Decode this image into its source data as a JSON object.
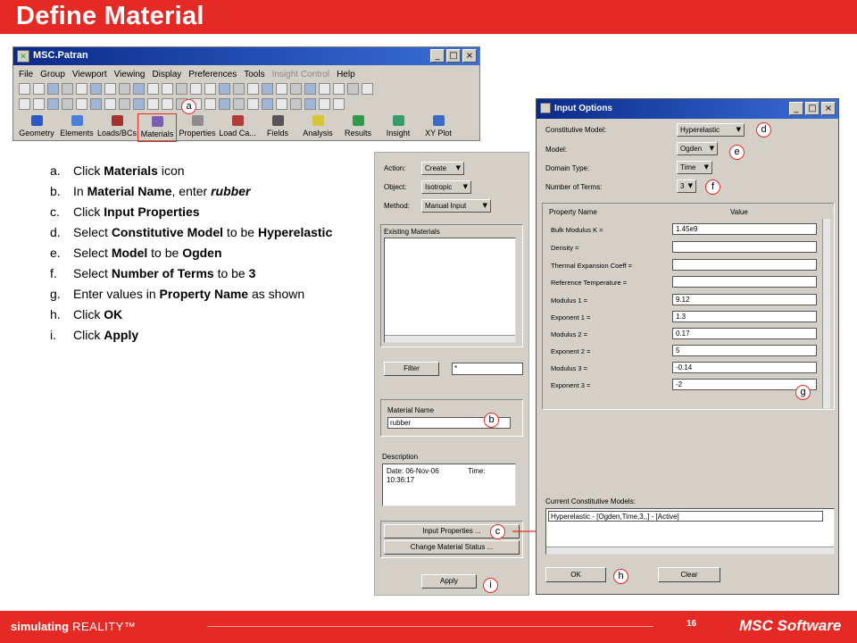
{
  "slide": {
    "title": "Define Material",
    "page_number": "16"
  },
  "patran_window": {
    "title": "MSC.Patran",
    "menu": [
      "File",
      "Group",
      "Viewport",
      "Viewing",
      "Display",
      "Preferences",
      "Tools",
      "Insight Control",
      "Help"
    ],
    "apps": [
      "Geometry",
      "Elements",
      "Loads/BCs",
      "Materials",
      "Properties",
      "Load Ca...",
      "Fields",
      "Analysis",
      "Results",
      "Insight",
      "XY Plot"
    ]
  },
  "steps": [
    {
      "letter": "a.",
      "pre": "Click ",
      "b1": "Materials",
      "mid": " icon",
      "b2": "",
      "post": ""
    },
    {
      "letter": "b.",
      "pre": "In ",
      "b1": "Material Name",
      "mid": ", enter ",
      "b2": "rubber",
      "post": ""
    },
    {
      "letter": "c.",
      "pre": "Click ",
      "b1": "Input Properties",
      "mid": "",
      "b2": "",
      "post": ""
    },
    {
      "letter": "d.",
      "pre": "Select ",
      "b1": "Constitutive Model",
      "mid": " to be ",
      "b2": "Hyperelastic",
      "post": ""
    },
    {
      "letter": "e.",
      "pre": "Select ",
      "b1": "Model",
      "mid": " to be ",
      "b2": "Ogden",
      "post": ""
    },
    {
      "letter": "f.",
      "pre": "Select ",
      "b1": "Number of Terms",
      "mid": " to be ",
      "b2": "3",
      "post": ""
    },
    {
      "letter": "g.",
      "pre": "Enter values in ",
      "b1": "Property Name",
      "mid": " as shown",
      "b2": "",
      "post": ""
    },
    {
      "letter": "h.",
      "pre": "Click ",
      "b1": "OK",
      "mid": "",
      "b2": "",
      "post": ""
    },
    {
      "letter": "i.",
      "pre": "Click ",
      "b1": "Apply",
      "mid": "",
      "b2": "",
      "post": ""
    }
  ],
  "materials_panel": {
    "action_label": "Action:",
    "action_value": "Create",
    "object_label": "Object:",
    "object_value": "Isotropic",
    "method_label": "Method:",
    "method_value": "Manual Input",
    "existing_materials_label": "Existing Materials",
    "filter_button": "Filter",
    "filter_value": "*",
    "material_name_label": "Material Name",
    "material_name_value": "rubber",
    "description_label": "Description",
    "description_line1": "Date: 06-Nov-06",
    "description_time": "Time:",
    "description_line2": "10:36:17",
    "input_properties_button": "Input Properties ...",
    "change_status_button": "Change Material Status ...",
    "apply_button": "Apply"
  },
  "input_options": {
    "title": "Input Options",
    "constitutive_model_label": "Constitutive Model:",
    "constitutive_model_value": "Hyperelastic",
    "model_label": "Model:",
    "model_value": "Ogden",
    "domain_type_label": "Domain Type:",
    "domain_type_value": "Time",
    "number_of_terms_label": "Number of Terms:",
    "number_of_terms_value": "3",
    "col_property": "Property Name",
    "col_value": "Value",
    "properties": [
      {
        "name": "Bulk Modulus K =",
        "value": "1.45e9"
      },
      {
        "name": "Density =",
        "value": ""
      },
      {
        "name": "Thermal Expansion Coeff =",
        "value": ""
      },
      {
        "name": "Reference Temperature =",
        "value": ""
      },
      {
        "name": "Modulus 1 =",
        "value": "9.12"
      },
      {
        "name": "Exponent 1 =",
        "value": "1.3"
      },
      {
        "name": "Modulus 2 =",
        "value": "0.17"
      },
      {
        "name": "Exponent 2 =",
        "value": "5"
      },
      {
        "name": "Modulus 3 =",
        "value": "-0.14"
      },
      {
        "name": "Exponent 3 =",
        "value": "-2"
      }
    ],
    "current_models_label": "Current Constitutive Models:",
    "current_model_value": "Hyperelastic - [Ogden,Time,3,,] - [Active]",
    "ok_button": "OK",
    "clear_button": "Clear"
  },
  "callouts": {
    "a": "a",
    "b": "b",
    "c": "c",
    "d": "d",
    "e": "e",
    "f": "f",
    "g": "g",
    "h": "h",
    "i": "i"
  },
  "footer": {
    "brand_bold": "simulating",
    "brand_rest": " REALITY™",
    "logo": "MSC Software"
  }
}
